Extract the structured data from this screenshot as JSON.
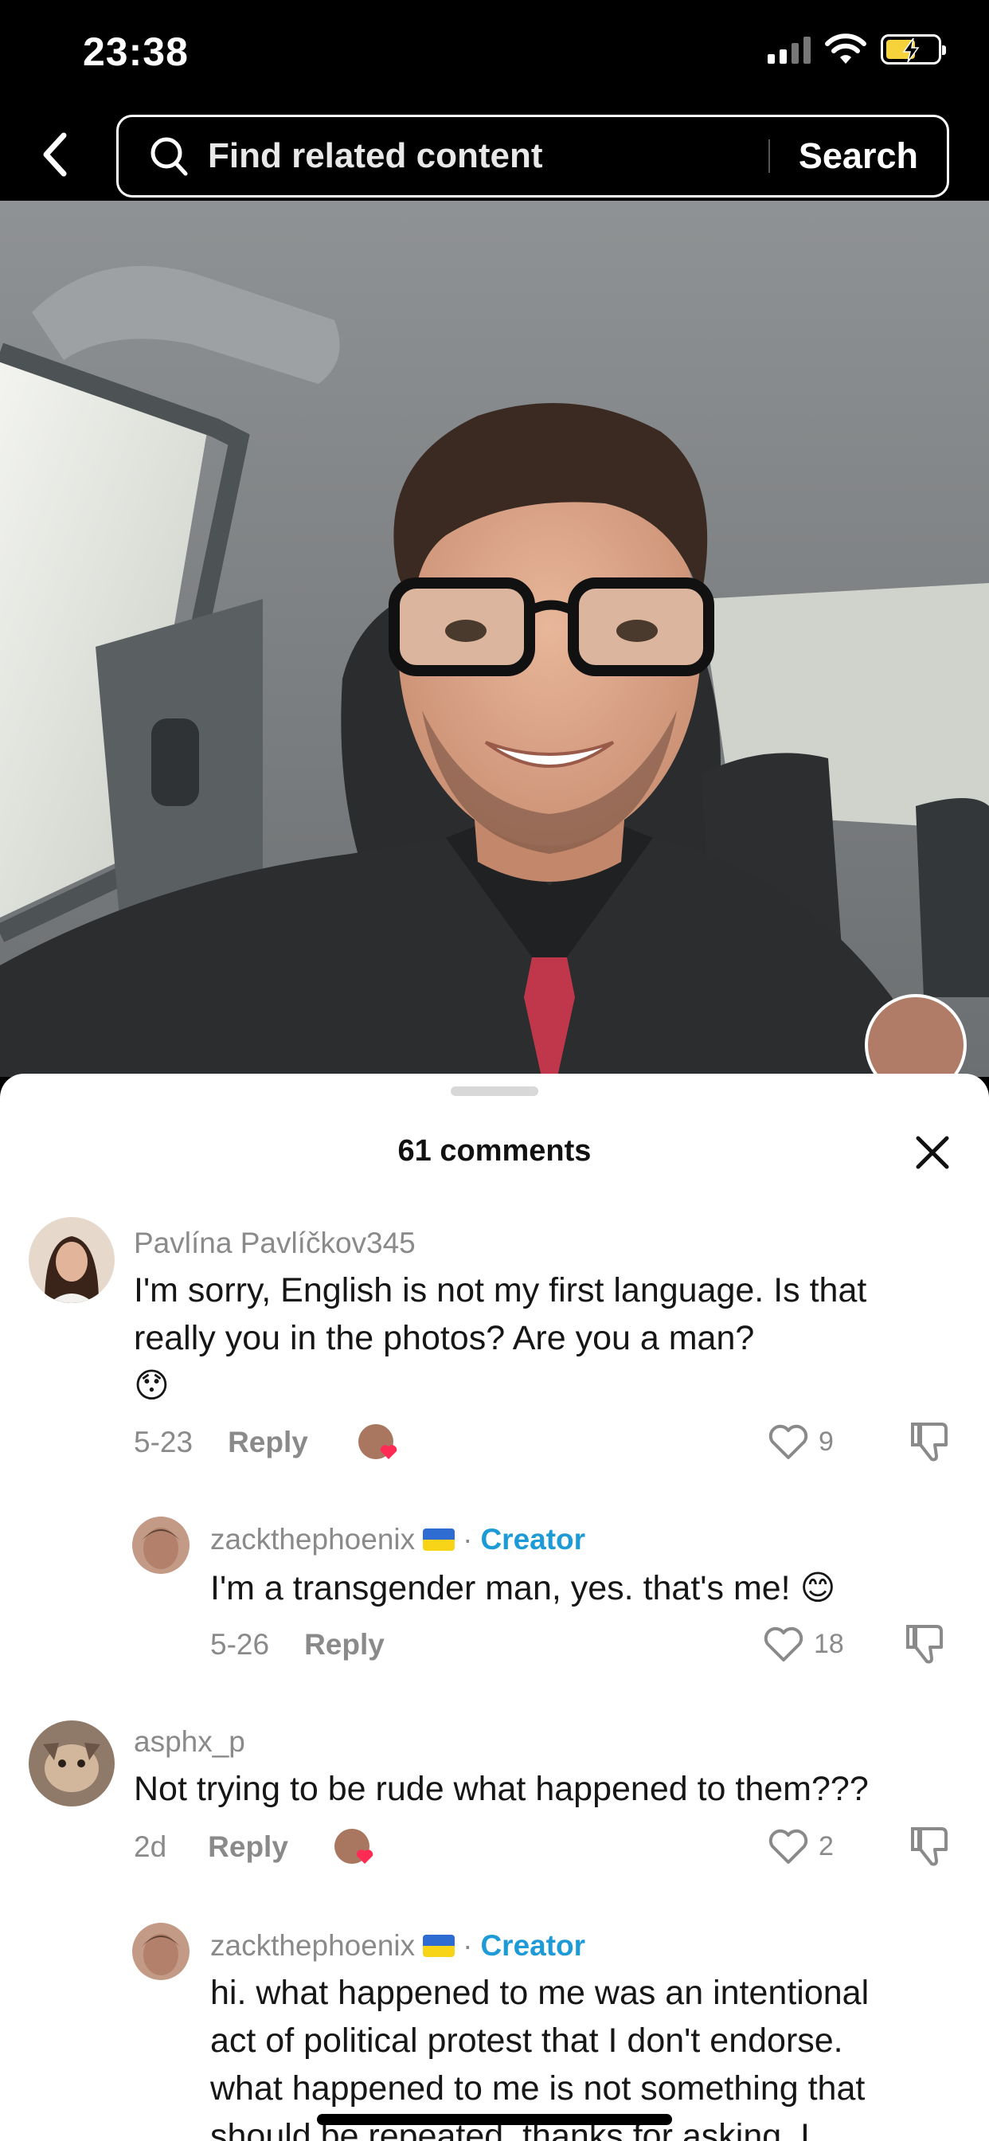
{
  "status_bar": {
    "time": "23:38"
  },
  "header": {
    "search_placeholder": "Find related content",
    "search_button": "Search"
  },
  "comments_sheet": {
    "title": "61 comments",
    "comments": [
      {
        "username": "Pavlína Pavlíčkov345",
        "text_line1": "I'm sorry, English is not my first language. Is that",
        "text_line2": "really you in the photos? Are you a man?",
        "emoji": "😯",
        "date": "5-23",
        "reply_label": "Reply",
        "likes": "9"
      },
      {
        "username": "zackthephoenix",
        "badge": "Creator",
        "separator": "·",
        "text": "I'm a transgender man, yes. that's me! 😊",
        "date": "5-26",
        "reply_label": "Reply",
        "likes": "18"
      },
      {
        "username": "asphx_p",
        "text": "Not trying to be rude what happened to them???",
        "date": "2d",
        "reply_label": "Reply",
        "likes": "2"
      },
      {
        "username": "zackthephoenix",
        "badge": "Creator",
        "separator": "·",
        "text_line1": "hi. what happened to me was an intentional",
        "text_line2": "act of political protest that I don't endorse.",
        "text_line3": "what happened to me is not something that",
        "text_line4": "should be repeated. thanks for asking. I"
      }
    ]
  },
  "colors": {
    "accent_creator": "#1e9bd7",
    "heart_pink": "#fe2c55",
    "battery_yellow": "#f6d33a"
  },
  "icons": [
    "back-chevron-icon",
    "search-icon",
    "close-icon",
    "heart-outline-icon",
    "dislike-icon",
    "liked-by-creator-icon",
    "ukraine-flag-icon"
  ]
}
